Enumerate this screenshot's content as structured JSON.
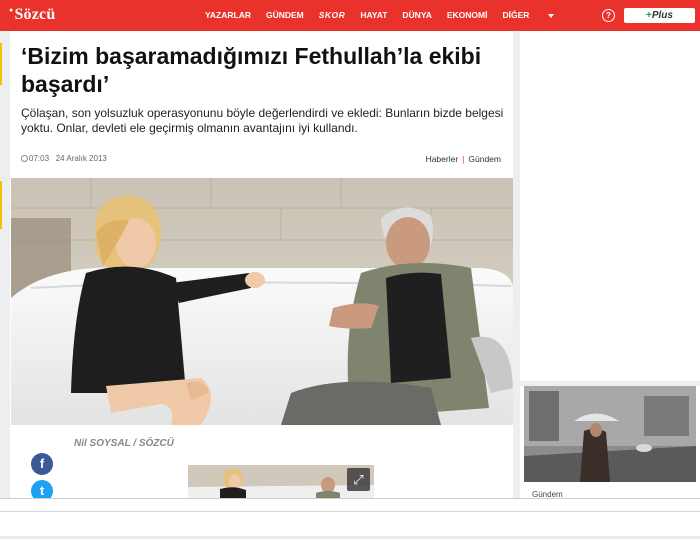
{
  "header": {
    "logo_text": "Sözcü",
    "nav": [
      "YAZARLAR",
      "GÜNDEM",
      "SKOR",
      "HAYAT",
      "DÜNYA",
      "EKONOMİ",
      "DİĞER"
    ],
    "help_symbol": "?",
    "plus_label": "Plus",
    "colors": {
      "brand_red": "#e8322b",
      "plus_green": "#2e9c3c"
    }
  },
  "article": {
    "headline": "‘Bizim başaramadığımızı Fethullah’la ekibi başardı’",
    "summary": "Çölaşan, son yolsuzluk operasyonunu böyle değerlendirdi ve ekledi: Bunların bizde belgesi yoktu. Onlar, devleti ele geçirmiş olmanın avantajını iyi kullandı.",
    "time": "07:03",
    "date": "24 Aralık 2013",
    "categories": [
      "Haberler",
      "Gündem"
    ],
    "author": "Nil SOYSAL / SÖZCÜ"
  },
  "social": {
    "facebook_glyph": "f",
    "twitter_glyph": "t",
    "facebook_color": "#3b5998",
    "twitter_color": "#1da1f2"
  },
  "media": {
    "expand_icon": "⤢"
  },
  "sidebar": {
    "story_label": "Gündem"
  }
}
